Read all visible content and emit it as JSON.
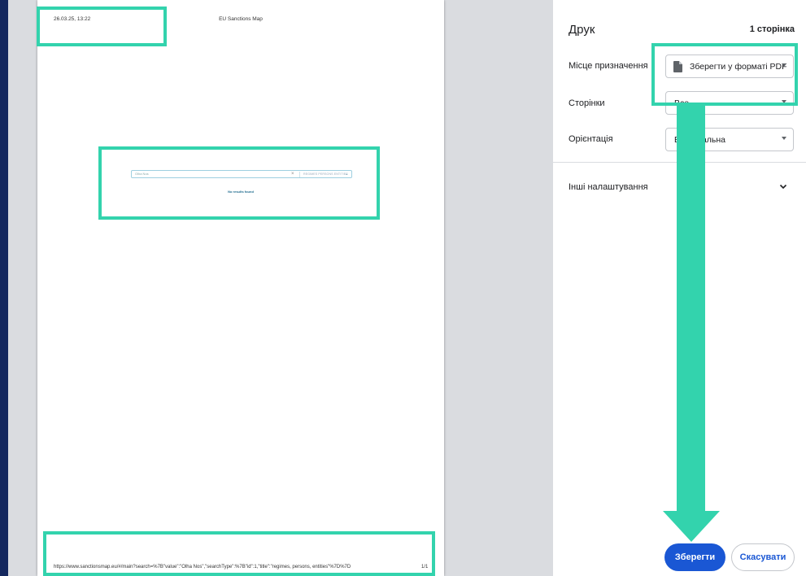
{
  "preview": {
    "header_date": "26.03.25, 13:22",
    "header_title": "EU Sanctions Map",
    "search_value": "Olha Nos",
    "search_clear": "×",
    "search_type": "REGIMES PERSONS ENTITIES",
    "search_chevron": "⌄",
    "no_results": "No results found",
    "footer_url": "https://www.sanctionsmap.eu/#/main?search=%7B\"value\":\"Olha Nos\",\"searchType\":%7B\"id\":1,\"title\":\"regimes, persons, entities\"%7D%7D",
    "footer_page": "1/1"
  },
  "settings": {
    "title": "Друк",
    "page_count": "1 сторінка",
    "destination_label": "Місце призначення",
    "destination_value": "Зберегти у форматі PDF",
    "destination_icon": "document-icon",
    "pages_label": "Сторінки",
    "pages_value": "Все",
    "orientation_label": "Орієнтація",
    "orientation_value": "Вертикальна",
    "more_settings_label": "Інші налаштування",
    "save_button": "Зберегти",
    "cancel_button": "Скасувати"
  },
  "colors": {
    "background": "#14285e",
    "highlight": "#33d3ad",
    "primary": "#1a57d4"
  }
}
